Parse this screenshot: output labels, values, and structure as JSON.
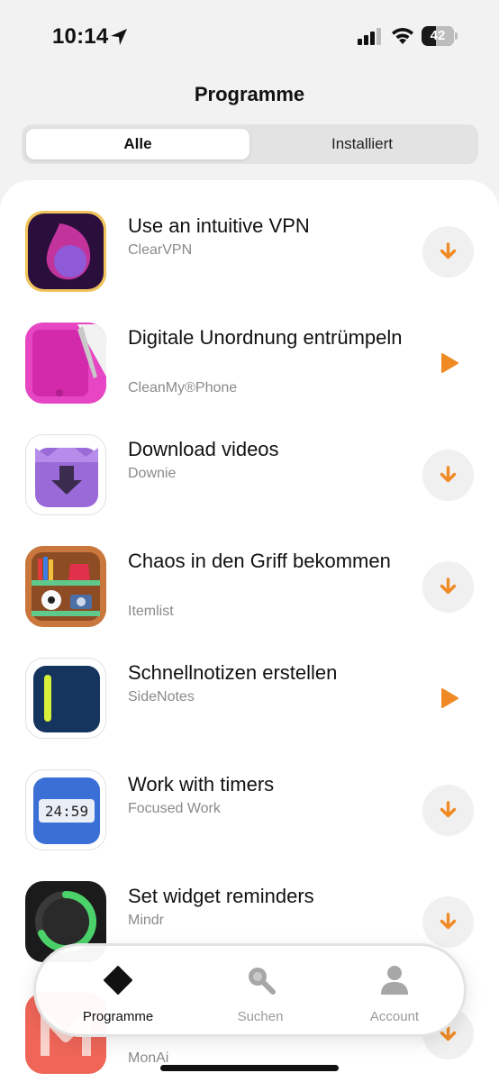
{
  "status_bar": {
    "time": "10:14",
    "battery": "42"
  },
  "header": {
    "title": "Programme"
  },
  "segments": [
    {
      "label": "Alle",
      "selected": true
    },
    {
      "label": "Installiert",
      "selected": false
    }
  ],
  "apps": [
    {
      "title": "Use an intuitive VPN",
      "name": "ClearVPN",
      "action": "download"
    },
    {
      "title": "Digitale Unordnung entrümpeln",
      "name": "CleanMy®Phone",
      "action": "open"
    },
    {
      "title": "Download videos",
      "name": "Downie",
      "action": "download"
    },
    {
      "title": "Chaos in den Griff bekommen",
      "name": "Itemlist",
      "action": "download"
    },
    {
      "title": "Schnellnotizen erstellen",
      "name": "SideNotes",
      "action": "open"
    },
    {
      "title": "Work with timers",
      "name": "Focused Work",
      "action": "download",
      "icon_text": "24:59"
    },
    {
      "title": "Set widget reminders",
      "name": "Mindr",
      "action": "download"
    },
    {
      "title": "",
      "name": "MonAi",
      "action": "download"
    }
  ],
  "tab_bar": {
    "items": [
      {
        "label": "Programme",
        "icon": "diamond-icon",
        "active": true
      },
      {
        "label": "Suchen",
        "icon": "search-icon",
        "active": false
      },
      {
        "label": "Account",
        "icon": "person-icon",
        "active": false
      }
    ]
  },
  "colors": {
    "accent": "#F08A24",
    "sheet": "#FFFFFF",
    "background": "#F2F2F2"
  }
}
